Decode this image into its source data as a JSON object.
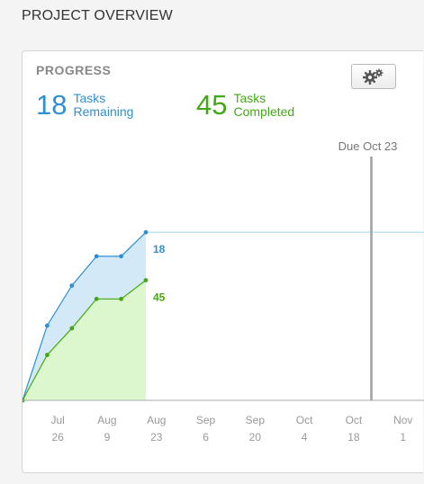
{
  "page": {
    "title": "PROJECT OVERVIEW"
  },
  "card": {
    "title": "PROGRESS",
    "settings_icon": "gears-icon"
  },
  "stats": {
    "remaining": {
      "value": "18",
      "label_line1": "Tasks",
      "label_line2": "Remaining"
    },
    "completed": {
      "value": "45",
      "label_line1": "Tasks",
      "label_line2": "Completed"
    }
  },
  "colors": {
    "remaining": "#2f8fd3",
    "completed": "#43a815",
    "remaining_fill": "#d4e9f7",
    "completed_fill": "#dcf7cd",
    "due_line": "#a0a0a0"
  },
  "chart_data": {
    "type": "area",
    "x_axis": {
      "type": "date",
      "ticks": [
        {
          "line1": "Jul",
          "line2": "26"
        },
        {
          "line1": "Aug",
          "line2": "9"
        },
        {
          "line1": "Aug",
          "line2": "23"
        },
        {
          "line1": "Sep",
          "line2": "6"
        },
        {
          "line1": "Sep",
          "line2": "20"
        },
        {
          "line1": "Oct",
          "line2": "4"
        },
        {
          "line1": "Oct",
          "line2": "18"
        },
        {
          "line1": "Nov",
          "line2": "1"
        }
      ]
    },
    "due_marker": {
      "label": "Due Oct 23"
    },
    "series": [
      {
        "name": "Tasks Remaining",
        "data_label": "18",
        "values": [
          {
            "date": "2015-07-16",
            "y": 0
          },
          {
            "date": "2015-07-23",
            "y": 28
          },
          {
            "date": "2015-07-30",
            "y": 43
          },
          {
            "date": "2015-08-06",
            "y": 54
          },
          {
            "date": "2015-08-13",
            "y": 54
          },
          {
            "date": "2015-08-20",
            "y": 63
          }
        ]
      },
      {
        "name": "Tasks Completed",
        "data_label": "45",
        "values": [
          {
            "date": "2015-07-16",
            "y": 0
          },
          {
            "date": "2015-07-23",
            "y": 17
          },
          {
            "date": "2015-07-30",
            "y": 27
          },
          {
            "date": "2015-08-06",
            "y": 38
          },
          {
            "date": "2015-08-13",
            "y": 38
          },
          {
            "date": "2015-08-20",
            "y": 45
          }
        ]
      }
    ],
    "ylim": [
      0,
      88
    ]
  }
}
